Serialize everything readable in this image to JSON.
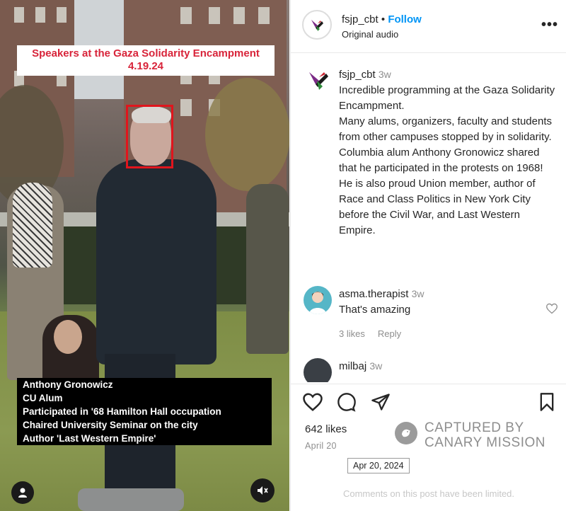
{
  "media": {
    "title_line1": "Speakers at the Gaza Solidarity Encampment",
    "title_line2": "4.19.24",
    "caption_lines": [
      "Anthony Gronowicz",
      "CU Alum",
      "Participated in '68 Hamilton Hall occupation",
      "Chaired University Seminar on the city",
      "Author 'Last Western Empire'"
    ]
  },
  "header": {
    "username": "fsjp_cbt",
    "separator": "•",
    "follow_label": "Follow",
    "subtitle": "Original audio",
    "more_label": "•••"
  },
  "post_caption": {
    "username": "fsjp_cbt",
    "time": "3w",
    "lines": [
      "Incredible programming at the Gaza Solidarity Encampment.",
      "Many alums, organizers, faculty and students from other campuses stopped by in solidarity.",
      "Columbia alum Anthony Gronowicz shared that he participated in the protests on 1968!",
      "He is also proud Union member, author of Race and Class Politics in New York City before the Civil War, and Last Western Empire."
    ]
  },
  "comments": [
    {
      "username": "asma.therapist",
      "time": "3w",
      "text": "That's amazing",
      "likes": "3 likes",
      "reply": "Reply"
    },
    {
      "username": "milbaj",
      "time": "3w",
      "text": "",
      "likes": "",
      "reply": ""
    }
  ],
  "actions": {
    "likes": "642 likes",
    "date": "April 20",
    "tooltip": "Apr 20, 2024",
    "comments_limited": "Comments on this post have been limited."
  },
  "watermark": {
    "line1": "CAPTURED BY",
    "line2": "CANARY MISSION"
  },
  "colors": {
    "follow": "#0095f6",
    "title_red": "#d8243a",
    "face_box": "#e0151d"
  }
}
